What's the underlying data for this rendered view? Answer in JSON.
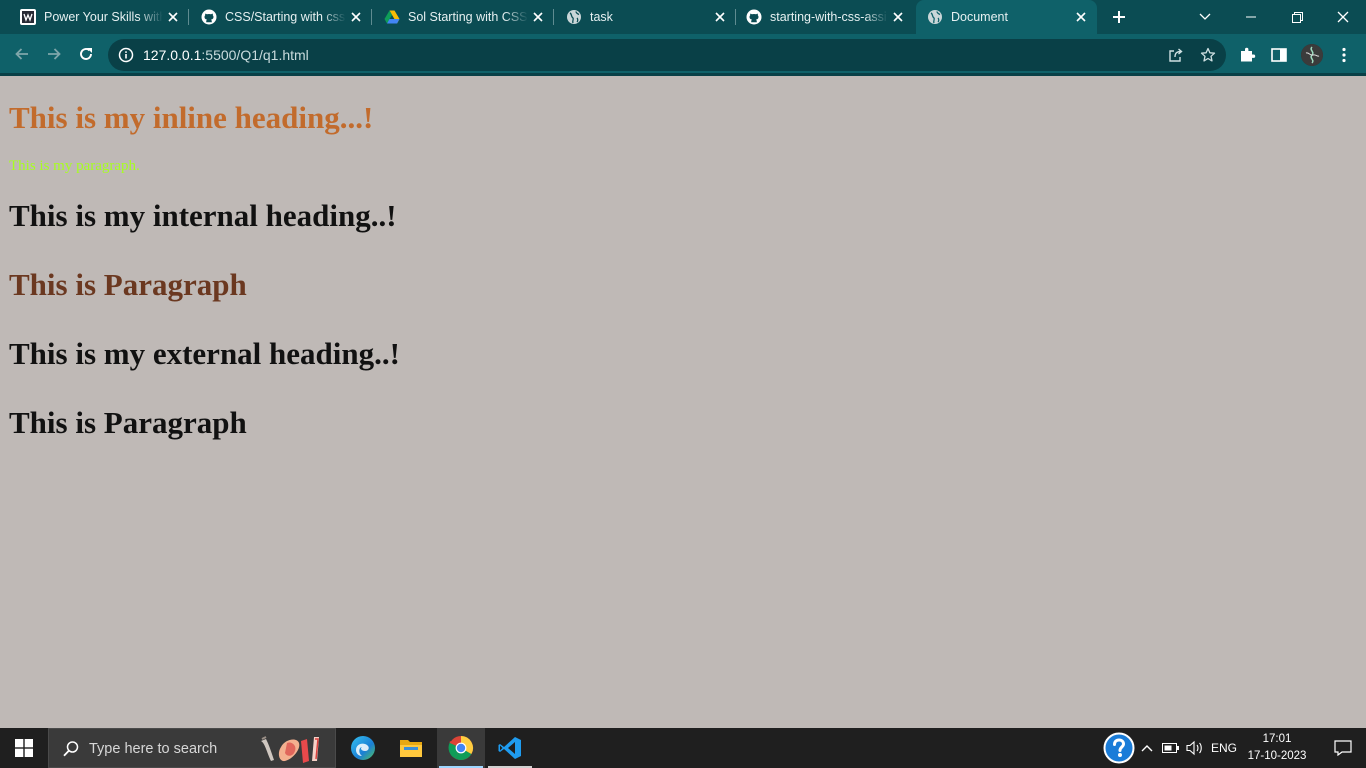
{
  "browser": {
    "tabs": [
      {
        "title": "Power Your Skills with",
        "icon": "w3-favicon-icon",
        "active": false
      },
      {
        "title": "CSS/Starting with css",
        "icon": "github-icon",
        "active": false
      },
      {
        "title": "Sol Starting with CSS",
        "icon": "google-drive-icon",
        "active": false
      },
      {
        "title": "task",
        "icon": "globe-icon",
        "active": false
      },
      {
        "title": "starting-with-css-assi",
        "icon": "github-icon",
        "active": false
      },
      {
        "title": "Document",
        "icon": "globe-icon",
        "active": true
      }
    ],
    "address": {
      "host": "127.0.0.1",
      "rest": ":5500/Q1/q1.html"
    },
    "colors": {
      "frame": "#0b4c53",
      "toolbar": "#0f6169"
    }
  },
  "page": {
    "background": "#bfb9b6",
    "inline_heading": "This is my inline heading...!",
    "paragraph_small": "This is my paragraph.",
    "internal_heading": "This is my internal heading..!",
    "paragraph_brown": "This is Paragraph",
    "external_heading": "This is my external heading..!",
    "paragraph_black": "This is Paragraph",
    "colors": {
      "inline_heading": "#c26b2c",
      "paragraph_small": "#a7ff1f",
      "paragraph_brown": "#6b3820",
      "default_text": "#111111"
    }
  },
  "taskbar": {
    "search_placeholder": "Type here to search",
    "pinned_apps": [
      "edge-icon",
      "file-explorer-icon",
      "chrome-icon",
      "vscode-icon"
    ],
    "active_app": "chrome-icon",
    "tray": {
      "language": "ENG",
      "time": "17:01",
      "date": "17-10-2023"
    }
  }
}
